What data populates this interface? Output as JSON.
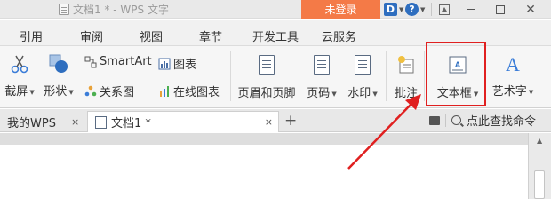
{
  "titlebar": {
    "doc_title": "文档1 * - WPS 文字",
    "login_label": "未登录",
    "d_label": "D",
    "help_label": "?"
  },
  "menu_tabs": [
    "引用",
    "审阅",
    "视图",
    "章节",
    "开发工具",
    "云服务"
  ],
  "ribbon": {
    "screenshot": "截屏",
    "shape": "形状",
    "smartart": "SmartArt",
    "chart": "图表",
    "relation": "关系图",
    "online_chart": "在线图表",
    "header_footer": "页眉和页脚",
    "page_number": "页码",
    "watermark": "水印",
    "comment": "批注",
    "textbox": "文本框",
    "wordart": "艺术字"
  },
  "doc_tabs": {
    "wps_tab": "我的WPS",
    "doc_tab": "文档1 *",
    "close_glyph": "×",
    "add_glyph": "+"
  },
  "search": {
    "label": "点此查找命令"
  },
  "colors": {
    "login_bg": "#f47a47",
    "highlight": "#e02020",
    "accent_blue": "#2e6ebf"
  }
}
